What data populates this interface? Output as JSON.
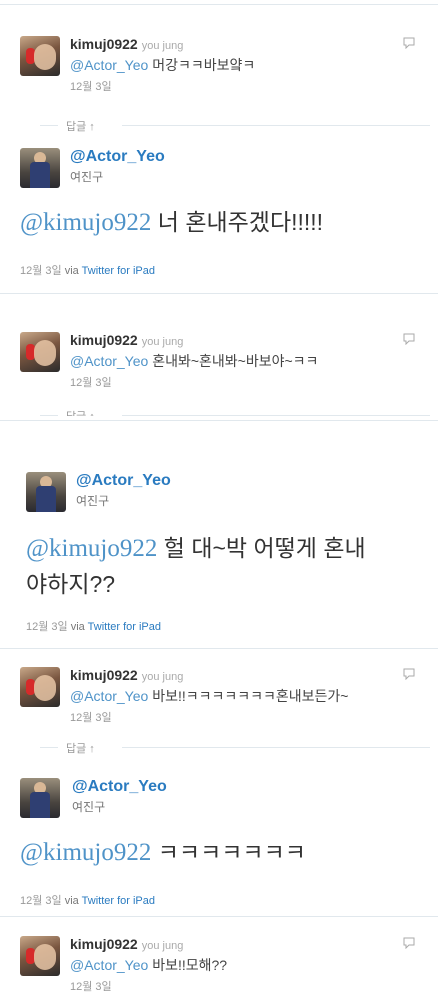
{
  "tweets": [
    {
      "username": "kimuj0922",
      "fullname": "you jung",
      "mention": "@Actor_Yeo",
      "text": " 머강ㅋㅋ바보얔ㅋ",
      "time": "12월 3일"
    },
    {
      "username": "kimuj0922",
      "fullname": "you jung",
      "mention": "@Actor_Yeo",
      "text": " 혼내봐~혼내봐~바보야~ㅋㅋ",
      "time": "12월 3일"
    },
    {
      "username": "kimuj0922",
      "fullname": "you jung",
      "mention": "@Actor_Yeo",
      "text": " 바보!!ㅋㅋㅋㅋㅋㅋㅋ혼내보든가~",
      "time": "12월 3일"
    },
    {
      "username": "kimuj0922",
      "fullname": "you jung",
      "mention": "@Actor_Yeo",
      "text": " 바보!!모해??",
      "time": "12월 3일"
    }
  ],
  "replies": [
    {
      "handle": "@Actor_Yeo",
      "name": "여진구",
      "mention": "@kimujo922",
      "text_line1": " 너 혼내주겠다!!!!!",
      "text_line2": "",
      "time": "12월 3일",
      "via": "via",
      "client": "Twitter for iPad"
    },
    {
      "handle": "@Actor_Yeo",
      "name": "여진구",
      "mention": "@kimujo922",
      "text_line1": " 헐 대~박 어떻게 혼내",
      "text_line2": "야하지??",
      "time": "12월 3일",
      "via": "via",
      "client": "Twitter for iPad"
    },
    {
      "handle": "@Actor_Yeo",
      "name": "여진구",
      "mention": "@kimujo922",
      "text_line1": " ㅋㅋㅋㅋㅋㅋㅋ",
      "text_line2": "",
      "time": "12월 3일",
      "via": "via",
      "client": "Twitter for iPad"
    }
  ],
  "reply_label": "답글 ↑",
  "reply_label_partial": "답글 ↑"
}
